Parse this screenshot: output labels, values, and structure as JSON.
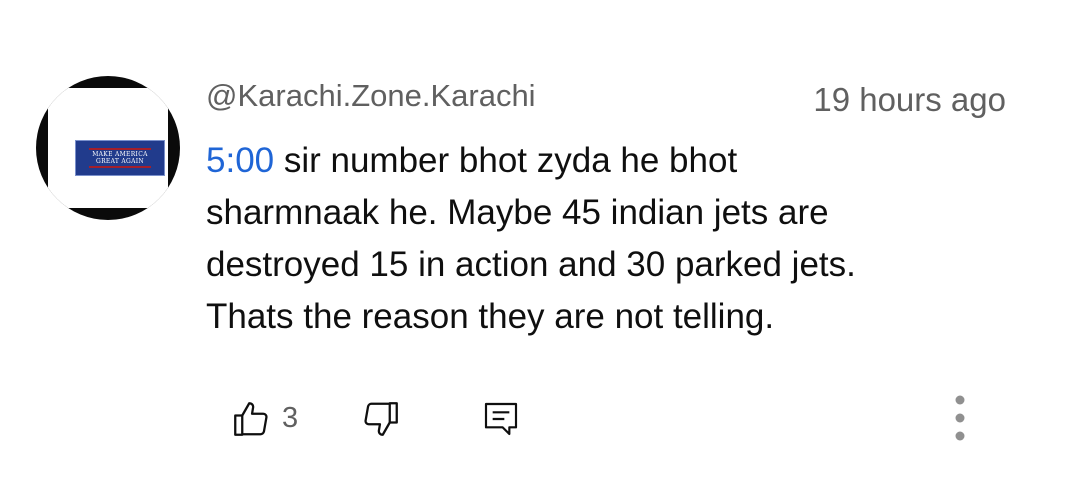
{
  "comment": {
    "avatar": {
      "flag_text_line1": "MAKE AMERICA",
      "flag_text_line2": "GREAT AGAIN"
    },
    "author": "@Karachi.Zone.Karachi",
    "timestamp": "19 hours ago",
    "timestamp_link": "5:00",
    "body_lines": [
      " sir number bhot zyda he bhot",
      "sharmnaak he. Maybe 45 indian jets are",
      "destroyed 15 in action and 30 parked jets.",
      "Thats the reason they are not telling."
    ],
    "like_count": "3"
  },
  "colors": {
    "link": "#1f65d6",
    "secondary_text": "#606060",
    "primary_text": "#0f0f0f"
  },
  "icons": {
    "like": "thumbs-up-icon",
    "dislike": "thumbs-down-icon",
    "reply": "reply-comment-icon",
    "more": "more-vertical-icon"
  }
}
